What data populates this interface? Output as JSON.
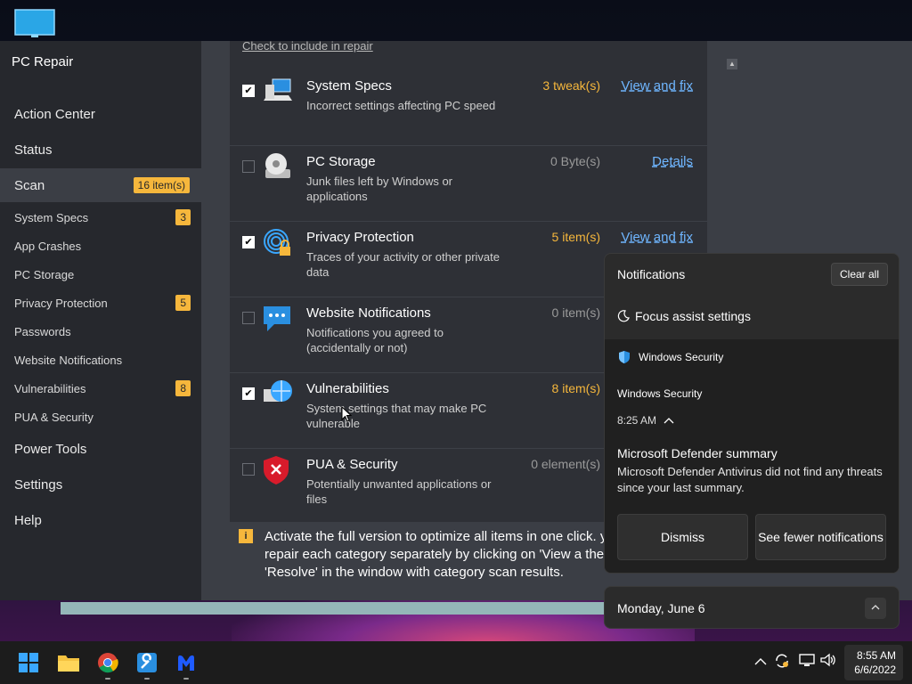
{
  "app": {
    "title": "PC Repair",
    "nav": [
      {
        "label": "Action Center"
      },
      {
        "label": "Status"
      },
      {
        "label": "Scan",
        "badge": "16 item(s)"
      },
      {
        "label": "Power Tools"
      },
      {
        "label": "Settings"
      },
      {
        "label": "Help"
      }
    ],
    "scan_sub": [
      {
        "label": "System Specs",
        "badge": "3"
      },
      {
        "label": "App Crashes"
      },
      {
        "label": "PC Storage"
      },
      {
        "label": "Privacy Protection",
        "badge": "5"
      },
      {
        "label": "Passwords"
      },
      {
        "label": "Website Notifications"
      },
      {
        "label": "Vulnerabilities",
        "badge": "8"
      },
      {
        "label": "PUA & Security"
      }
    ],
    "list_header": "Check to include in repair",
    "rows": [
      {
        "title": "System Specs",
        "desc": "Incorrect settings affecting PC speed",
        "count": "3 tweak(s)",
        "link": "View and fix",
        "checked": true
      },
      {
        "title": "PC Storage",
        "desc": "Junk files left by Windows or applications",
        "count": "0 Byte(s)",
        "link": "Details",
        "checked": false
      },
      {
        "title": "Privacy Protection",
        "desc": "Traces of your activity or other private data",
        "count": "5 item(s)",
        "link": "View and fix",
        "checked": true
      },
      {
        "title": "Website Notifications",
        "desc": "Notifications you agreed to (accidentally or not)",
        "count": "0 item(s)",
        "link": "",
        "checked": false
      },
      {
        "title": "Vulnerabilities",
        "desc": "System settings that may make PC vulnerable",
        "count": "8 item(s)",
        "link": "",
        "checked": true
      },
      {
        "title": "PUA & Security",
        "desc": "Potentially unwanted applications or files",
        "count": "0 element(s)",
        "link": "",
        "checked": false
      }
    ],
    "info_text": "Activate the full version to optimize all items in one click. you repair each category separately by clicking on 'View a then on 'Resolve' in the window with category scan results."
  },
  "notifications": {
    "title": "Notifications",
    "clear_all": "Clear all",
    "focus_assist": "Focus assist settings",
    "card": {
      "app_name": "Windows Security",
      "subtitle": "Windows Security",
      "time": "8:25 AM",
      "headline": "Microsoft Defender summary",
      "body": "Microsoft Defender Antivirus did not find any threats since your last summary.",
      "dismiss": "Dismiss",
      "see_fewer": "See fewer notifications"
    }
  },
  "calendar": {
    "date": "Monday, June 6"
  },
  "taskbar": {
    "apps": [
      "windows-start",
      "file-explorer",
      "chrome",
      "pc-repair-tool",
      "malwarebytes"
    ],
    "clock_time": "8:55 AM",
    "clock_date": "6/6/2022"
  },
  "colors": {
    "accent": "#f6b73c",
    "link": "#6fb6ff",
    "sidebar": "#26282d"
  }
}
